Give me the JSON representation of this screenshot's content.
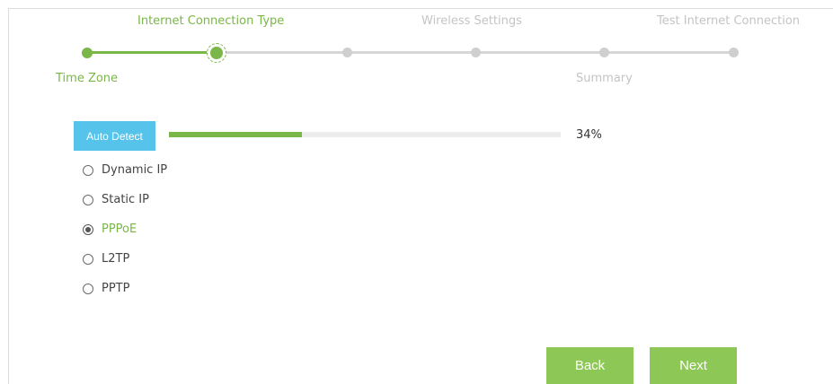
{
  "steps": [
    {
      "label": "Time Zone",
      "state": "done"
    },
    {
      "label": "Internet Connection Type",
      "state": "current"
    },
    {
      "label": "Wireless Settings",
      "state": "todo"
    },
    {
      "label": "Summary",
      "state": "todo"
    },
    {
      "label": "Test Internet Connection",
      "state": "todo"
    }
  ],
  "detect": {
    "button_label": "Auto Detect",
    "progress_percent": 34,
    "progress_text": "34%"
  },
  "options": [
    {
      "label": "Dynamic IP",
      "selected": false
    },
    {
      "label": "Static IP",
      "selected": false
    },
    {
      "label": "PPPoE",
      "selected": true
    },
    {
      "label": "L2TP",
      "selected": false
    },
    {
      "label": "PPTP",
      "selected": false
    }
  ],
  "actions": {
    "back_label": "Back",
    "next_label": "Next"
  },
  "colors": {
    "accent": "#7ab648",
    "detect_button": "#56c3ea",
    "action_button": "#8dc756",
    "inactive": "#cfcfcf"
  }
}
